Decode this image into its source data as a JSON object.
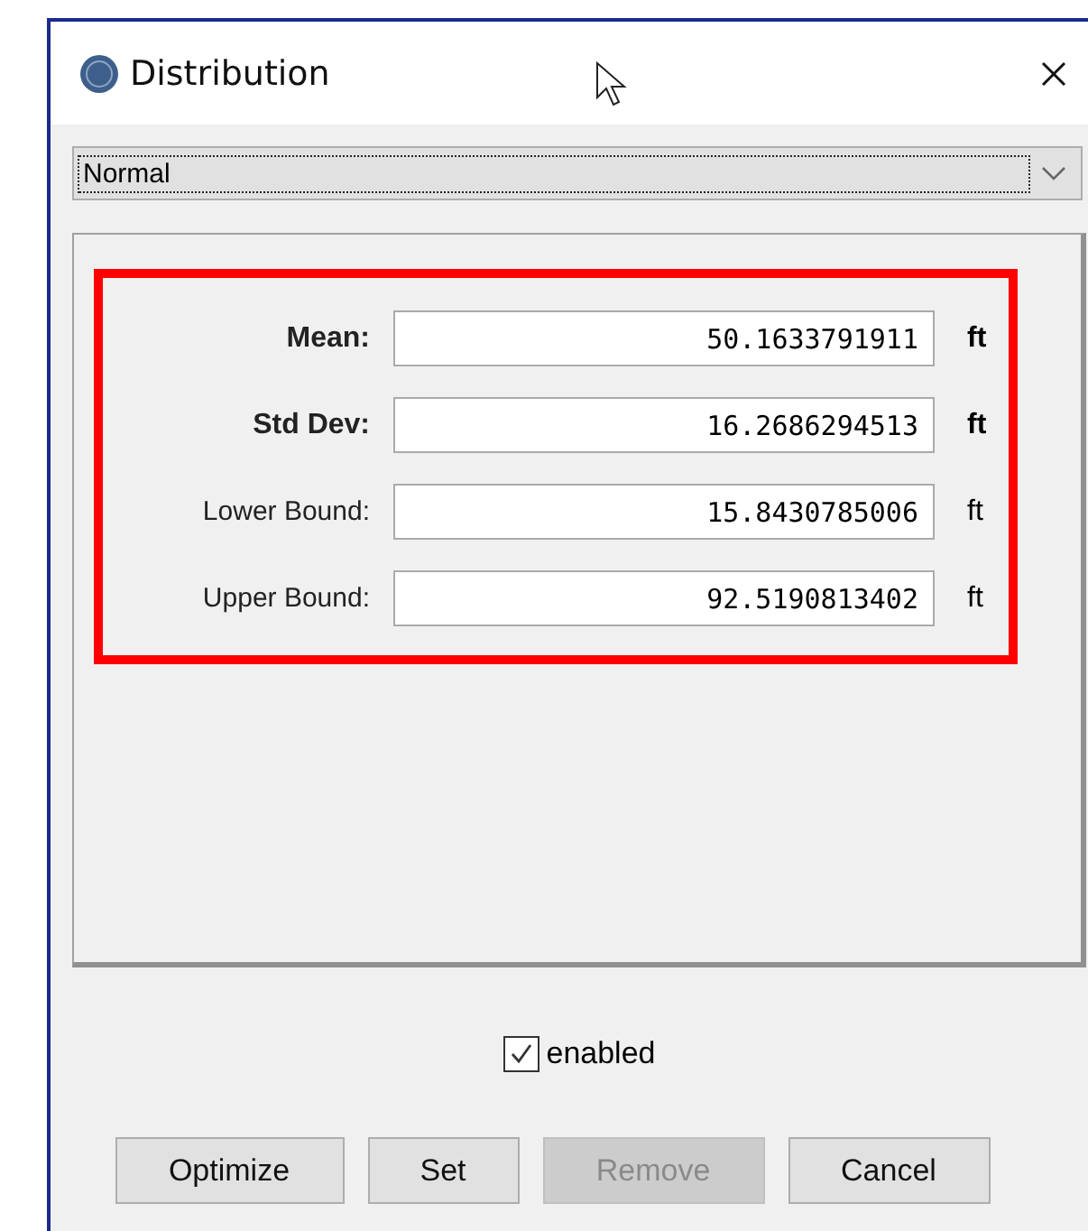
{
  "window": {
    "title": "Distribution"
  },
  "distribution_select": {
    "value": "Normal"
  },
  "parameters": [
    {
      "label": "Mean:",
      "value": "50.1633791911",
      "unit": "ft",
      "bold": true
    },
    {
      "label": "Std Dev:",
      "value": "16.2686294513",
      "unit": "ft",
      "bold": true
    },
    {
      "label": "Lower Bound:",
      "value": "15.8430785006",
      "unit": "ft",
      "bold": false
    },
    {
      "label": "Upper Bound:",
      "value": "92.5190813402",
      "unit": "ft",
      "bold": false
    }
  ],
  "enabled": {
    "label": "enabled",
    "checked": true
  },
  "buttons": [
    {
      "label": "Optimize",
      "disabled": false
    },
    {
      "label": "Set",
      "disabled": false
    },
    {
      "label": "Remove",
      "disabled": true
    },
    {
      "label": "Cancel",
      "disabled": false
    }
  ]
}
